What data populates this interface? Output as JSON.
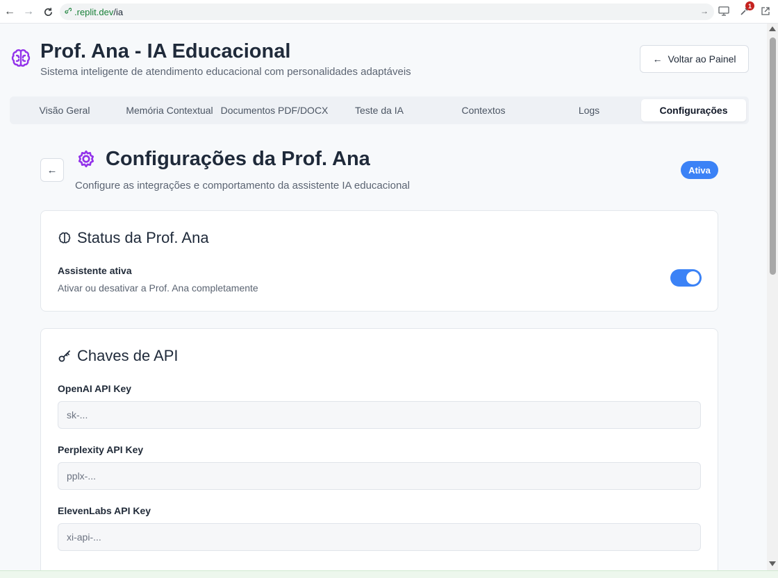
{
  "browser": {
    "url_host": ".replit.dev",
    "url_path": "/ia",
    "extension_badge": "1"
  },
  "header": {
    "title": "Prof. Ana - IA Educacional",
    "subtitle": "Sistema inteligente de atendimento educacional com personalidades adaptáveis",
    "back_button": "Voltar ao Painel"
  },
  "tabs": [
    {
      "label": "Visão Geral"
    },
    {
      "label": "Memória Contextual"
    },
    {
      "label": "Documentos PDF/DOCX"
    },
    {
      "label": "Teste da IA"
    },
    {
      "label": "Contextos"
    },
    {
      "label": "Logs"
    },
    {
      "label": "Configurações",
      "active": true
    }
  ],
  "page": {
    "title": "Configurações da Prof. Ana",
    "subtitle": "Configure as integrações e comportamento da assistente IA educacional",
    "status_badge": "Ativa"
  },
  "status_card": {
    "title": "Status da Prof. Ana",
    "toggle_label": "Assistente ativa",
    "toggle_description": "Ativar ou desativar a Prof. Ana completamente",
    "toggle_on": true
  },
  "api_card": {
    "title": "Chaves de API",
    "fields": [
      {
        "label": "OpenAI API Key",
        "placeholder": "sk-..."
      },
      {
        "label": "Perplexity API Key",
        "placeholder": "pplx-..."
      },
      {
        "label": "ElevenLabs API Key",
        "placeholder": "xi-api-..."
      }
    ]
  },
  "colors": {
    "accent": "#3b82f6",
    "brand_icon": "#9333ea"
  }
}
